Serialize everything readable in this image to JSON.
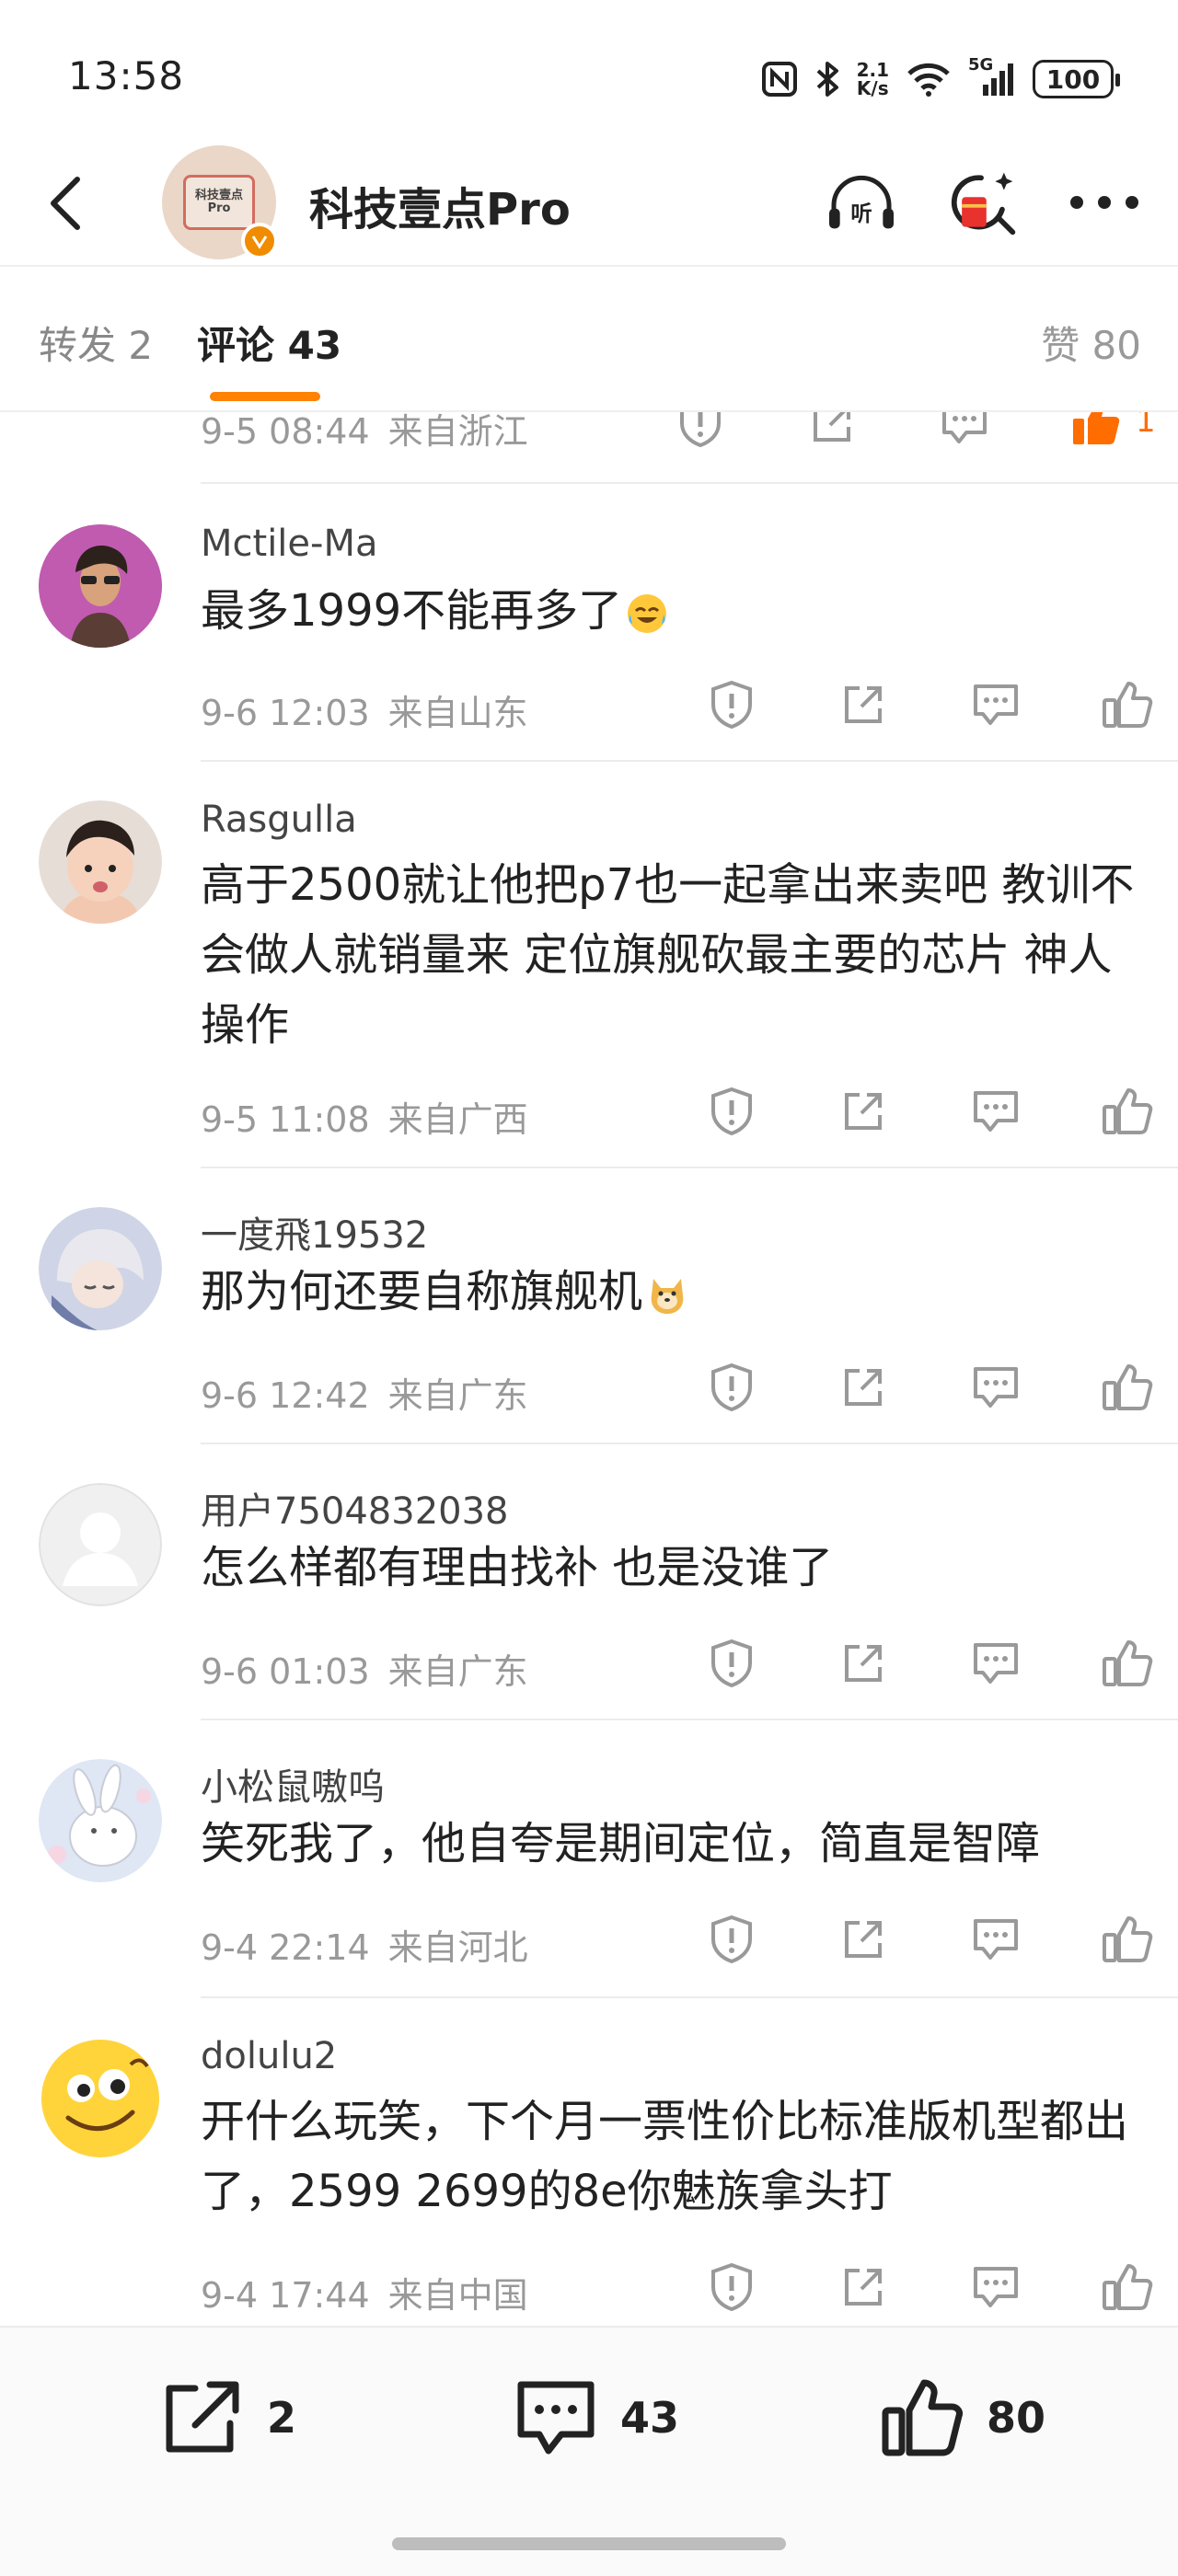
{
  "status_bar": {
    "time": "13:58",
    "net_speed_value": "2.1",
    "net_speed_unit": "K/s",
    "network": "5G",
    "battery": "100"
  },
  "header": {
    "account_name": "科技壹点Pro",
    "avatar_text": "科技壹点Pro"
  },
  "tabs": {
    "repost": "转发 2",
    "comments": "评论 43",
    "likes": "赞 80"
  },
  "comments": [
    {
      "time": "9-5 08:44",
      "location": "来自浙江",
      "like_count": "1"
    },
    {
      "user": "Mctile-Ma",
      "text": "最多1999不能再多了",
      "time": "9-6 12:03",
      "location": "来自山东"
    },
    {
      "user": "Rasgulla",
      "text": "高于2500就让他把p7也一起拿出来卖吧  教训不会做人就销量来   定位旗舰砍最主要的芯片  神人操作",
      "time": "9-5 11:08",
      "location": "来自广西"
    },
    {
      "user": "一度飛19532",
      "text": "那为何还要自称旗舰机",
      "time": "9-6 12:42",
      "location": "来自广东"
    },
    {
      "user": "用户7504832038",
      "text": "怎么样都有理由找补  也是没谁了",
      "time": "9-6 01:03",
      "location": "来自广东"
    },
    {
      "user": "小松鼠嗷呜",
      "text": "笑死我了，他自夸是期间定位，简直是智障",
      "time": "9-4 22:14",
      "location": "来自河北"
    },
    {
      "user": "dolulu2",
      "text": "开什么玩笑，下个月一票性价比标准版机型都出了，2599 2699的8e你魅族拿头打",
      "time": "9-4 17:44",
      "location": "来自中国"
    }
  ],
  "bottom_bar": {
    "reposts": "2",
    "comments": "43",
    "likes": "80"
  },
  "colors": {
    "accent": "#ff8200",
    "like_active": "#ff6c00",
    "meta_gray": "#999999"
  }
}
